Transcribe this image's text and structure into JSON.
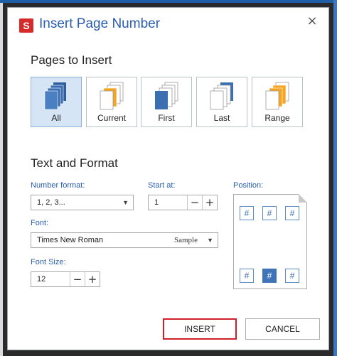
{
  "dialog": {
    "app_icon": "S",
    "title": "Insert Page Number",
    "close": "×"
  },
  "pages_section": {
    "title": "Pages to Insert",
    "options": [
      {
        "label": "All",
        "icon": "all-pages-icon",
        "selected": true
      },
      {
        "label": "Current",
        "icon": "current-page-icon",
        "selected": false
      },
      {
        "label": "First",
        "icon": "first-page-icon",
        "selected": false
      },
      {
        "label": "Last",
        "icon": "last-page-icon",
        "selected": false
      },
      {
        "label": "Range",
        "icon": "range-pages-icon",
        "selected": false
      }
    ]
  },
  "format_section": {
    "title": "Text and Format",
    "number_format": {
      "label": "Number format:",
      "value": "1, 2, 3..."
    },
    "start_at": {
      "label": "Start at:",
      "value": "1"
    },
    "font": {
      "label": "Font:",
      "value": "Times New Roman",
      "sample": "Sample"
    },
    "font_size": {
      "label": "Font Size:",
      "value": "12"
    },
    "position": {
      "label": "Position:",
      "cell_symbol": "#",
      "selected": "bottom-center"
    }
  },
  "stepper_symbols": {
    "minus": "−",
    "plus": "+"
  },
  "buttons": {
    "insert": "INSERT",
    "cancel": "CANCEL"
  },
  "colors": {
    "accent": "#2a5db0",
    "selected_bg": "#d5e5f6",
    "primary_border": "#d11f2a"
  }
}
